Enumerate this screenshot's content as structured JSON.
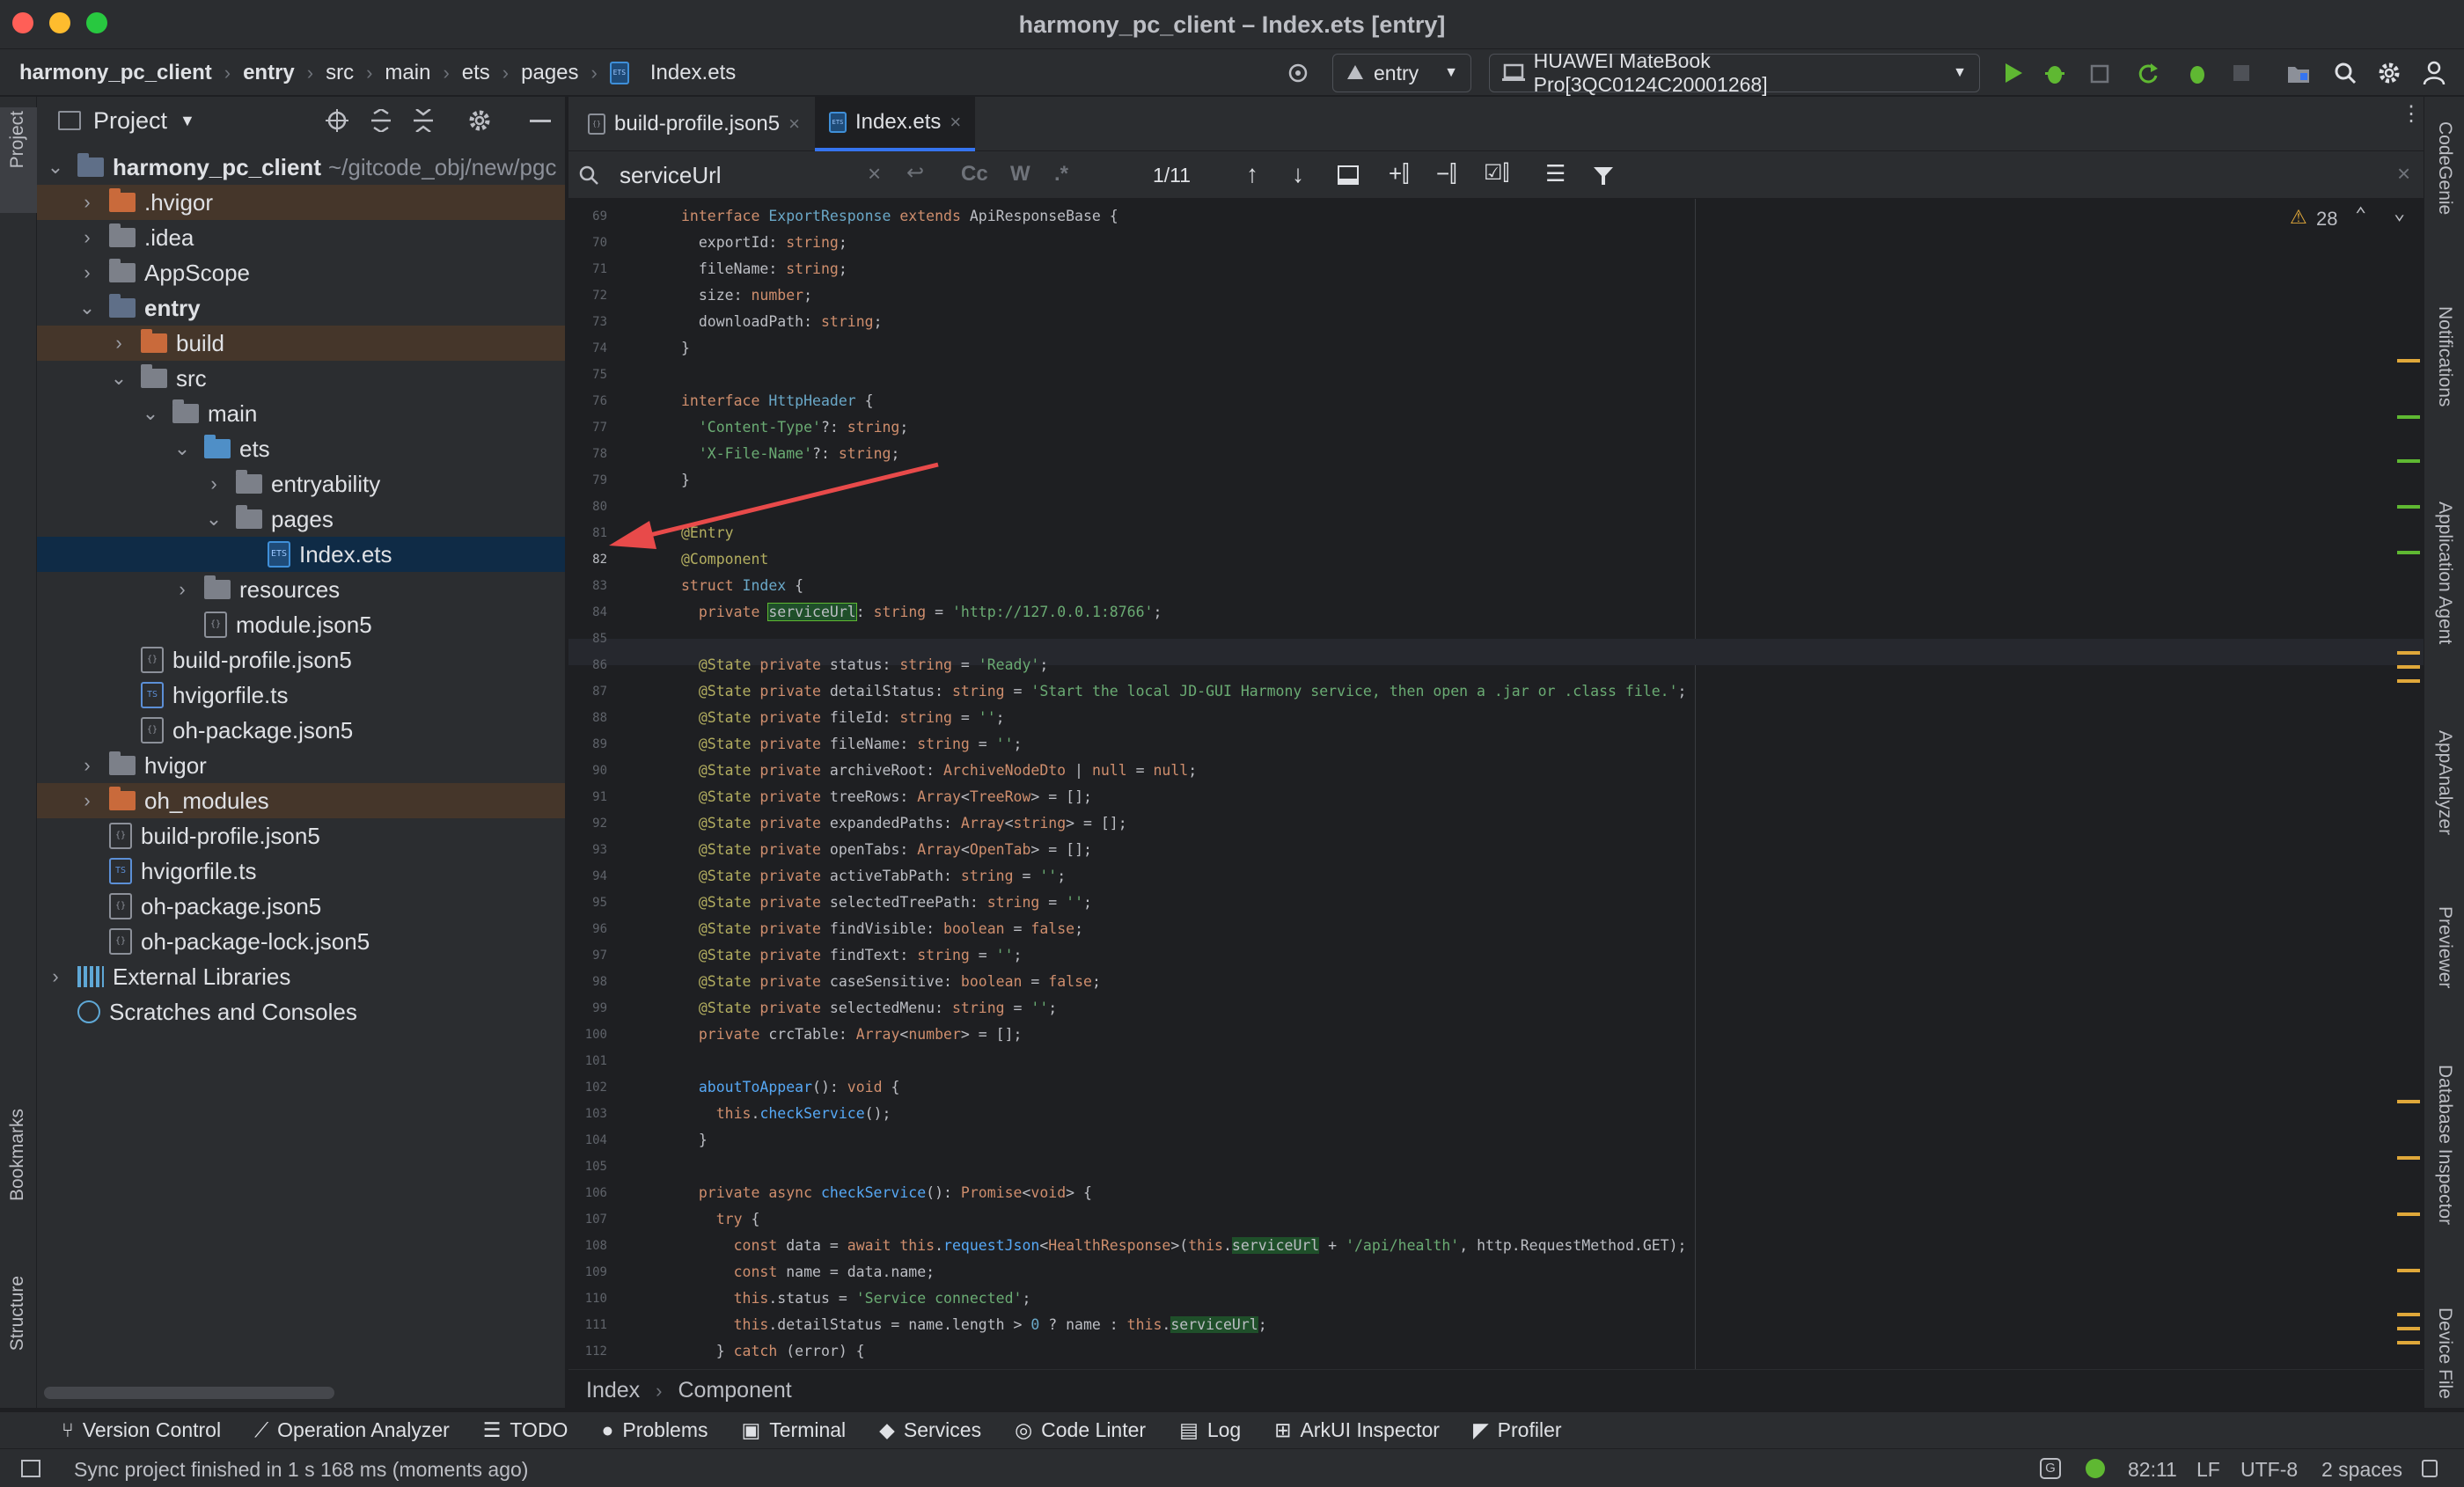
{
  "window": {
    "title": "harmony_pc_client – Index.ets [entry]"
  },
  "breadcrumb": [
    "harmony_pc_client",
    "entry",
    "src",
    "main",
    "ets",
    "pages",
    "Index.ets"
  ],
  "toolbar": {
    "config": "entry",
    "device": "HUAWEI MateBook Pro[3QC0124C20001268]"
  },
  "project": {
    "title": "Project",
    "root": "harmony_pc_client",
    "root_path": "~/gitcode_obj/new/pgc",
    "items": [
      ".hvigor",
      ".idea",
      "AppScope",
      "entry",
      "build",
      "src",
      "main",
      "ets",
      "entryability",
      "pages",
      "Index.ets",
      "resources",
      "module.json5",
      "build-profile.json5",
      "hvigorfile.ts",
      "oh-package.json5",
      "hvigor",
      "oh_modules",
      "build-profile.json5",
      "hvigorfile.ts",
      "oh-package.json5",
      "oh-package-lock.json5",
      "External Libraries",
      "Scratches and Consoles"
    ]
  },
  "left_strip": {
    "project": "Project",
    "bookmarks": "Bookmarks",
    "structure": "Structure"
  },
  "tabs": [
    {
      "label": "build-profile.json5"
    },
    {
      "label": "Index.ets"
    }
  ],
  "find": {
    "query": "serviceUrl",
    "cc": "Cc",
    "w": "W",
    "regex": ".*",
    "count": "1/11"
  },
  "warnings": {
    "count": "28"
  },
  "code_breadcrumb": [
    "Index",
    "Component"
  ],
  "right_tools": [
    "CodeGenie",
    "Notifications",
    "Application Agent",
    "AppAnalyzer",
    "Previewer",
    "Database Inspector",
    "Device File"
  ],
  "tool_windows": [
    "Version Control",
    "Operation Analyzer",
    "TODO",
    "Problems",
    "Terminal",
    "Services",
    "Code Linter",
    "Log",
    "ArkUI Inspector",
    "Profiler"
  ],
  "status": {
    "message": "Sync project finished in 1 s 168 ms (moments ago)",
    "position": "82:11",
    "line_sep": "LF",
    "encoding": "UTF-8",
    "indent": "2 spaces"
  },
  "colors": {
    "accent": "#3574f0",
    "arrow": "#e84a4a",
    "run": "#5fb832"
  }
}
